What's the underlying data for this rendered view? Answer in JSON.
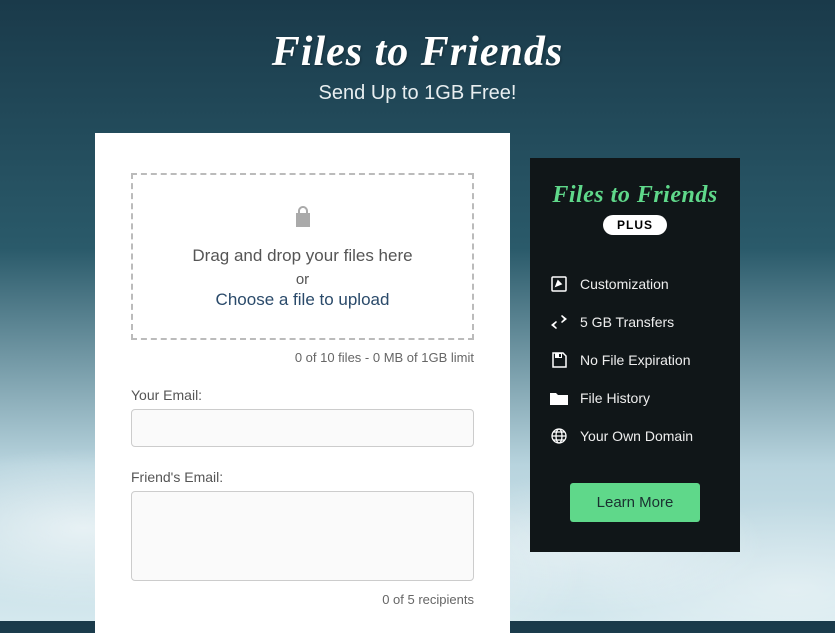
{
  "header": {
    "title": "Files to Friends",
    "subtitle": "Send Up to 1GB Free!"
  },
  "dropzone": {
    "text": "Drag and drop your files here",
    "or": "or",
    "choose": "Choose a file to upload",
    "status": "0 of 10 files - 0 MB of 1GB limit"
  },
  "form": {
    "your_email_label": "Your Email:",
    "your_email_value": "",
    "friends_email_label": "Friend's Email:",
    "friends_email_value": "",
    "recipients_status": "0 of 5 recipients"
  },
  "sidebar": {
    "title": "Files to Friends",
    "badge": "PLUS",
    "features": {
      "customization": "Customization",
      "transfers": "5 GB Transfers",
      "expiration": "No File Expiration",
      "history": "File History",
      "domain": "Your Own Domain"
    },
    "learn_more": "Learn More"
  }
}
